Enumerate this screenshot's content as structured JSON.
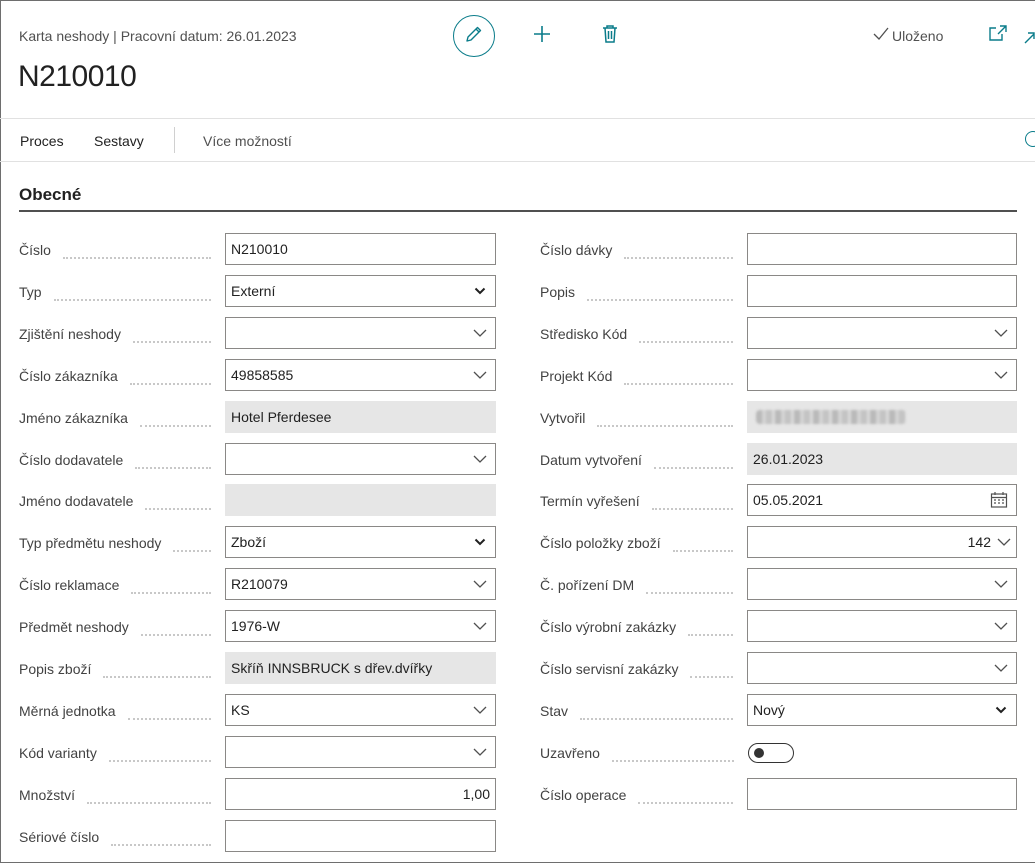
{
  "header": {
    "breadcrumb": "Karta neshody | Pracovní datum: 26.01.2023",
    "record_no": "N210010",
    "saved_label": "Uloženo",
    "icons": [
      "edit-icon",
      "add-icon",
      "delete-icon",
      "checkmark-icon",
      "popout-icon",
      "collapse-icon"
    ],
    "accent_color": "#0a7c8a"
  },
  "actions": {
    "items": [
      "Proces",
      "Sestavy"
    ],
    "more_label": "Více možností"
  },
  "section": {
    "title": "Obecné"
  },
  "left_fields": [
    {
      "label": "Číslo",
      "value": "N210010",
      "kind": "text"
    },
    {
      "label": "Typ",
      "value": "Externí",
      "kind": "select"
    },
    {
      "label": "Zjištění neshody",
      "value": "",
      "kind": "lookup"
    },
    {
      "label": "Číslo zákazníka",
      "value": "49858585",
      "kind": "lookup"
    },
    {
      "label": "Jméno zákazníka",
      "value": "Hotel Pferdesee",
      "kind": "readonly"
    },
    {
      "label": "Číslo dodavatele",
      "value": "",
      "kind": "lookup"
    },
    {
      "label": "Jméno dodavatele",
      "value": "",
      "kind": "readonly"
    },
    {
      "label": "Typ předmětu neshody",
      "value": "Zboží",
      "kind": "select"
    },
    {
      "label": "Číslo reklamace",
      "value": "R210079",
      "kind": "lookup"
    },
    {
      "label": "Předmět neshody",
      "value": "1976-W",
      "kind": "lookup"
    },
    {
      "label": "Popis zboží",
      "value": "Skříň INNSBRUCK s dřev.dvířky",
      "kind": "readonly"
    },
    {
      "label": "Měrná jednotka",
      "value": "KS",
      "kind": "lookup"
    },
    {
      "label": "Kód varianty",
      "value": "",
      "kind": "lookup"
    },
    {
      "label": "Množství",
      "value": "1,00",
      "kind": "number"
    },
    {
      "label": "Sériové číslo",
      "value": "",
      "kind": "text"
    }
  ],
  "right_fields": [
    {
      "label": "Číslo dávky",
      "value": "",
      "kind": "text"
    },
    {
      "label": "Popis",
      "value": "",
      "kind": "text"
    },
    {
      "label": "Středisko Kód",
      "value": "",
      "kind": "lookup"
    },
    {
      "label": "Projekt Kód",
      "value": "",
      "kind": "lookup"
    },
    {
      "label": "Vytvořil",
      "value": "",
      "kind": "blurred"
    },
    {
      "label": "Datum vytvoření",
      "value": "26.01.2023",
      "kind": "readonly"
    },
    {
      "label": "Termín vyřešení",
      "value": "05.05.2021",
      "kind": "date"
    },
    {
      "label": "Číslo položky zboží",
      "value": "142",
      "kind": "lookup-number"
    },
    {
      "label": "Č. pořízení DM",
      "value": "",
      "kind": "lookup"
    },
    {
      "label": "Číslo výrobní zakázky",
      "value": "",
      "kind": "lookup"
    },
    {
      "label": "Číslo servisní zakázky",
      "value": "",
      "kind": "lookup"
    },
    {
      "label": "Stav",
      "value": "Nový",
      "kind": "select"
    },
    {
      "label": "Uzavřeno",
      "value": "Off",
      "kind": "toggle"
    },
    {
      "label": "Číslo operace",
      "value": "",
      "kind": "text"
    }
  ]
}
